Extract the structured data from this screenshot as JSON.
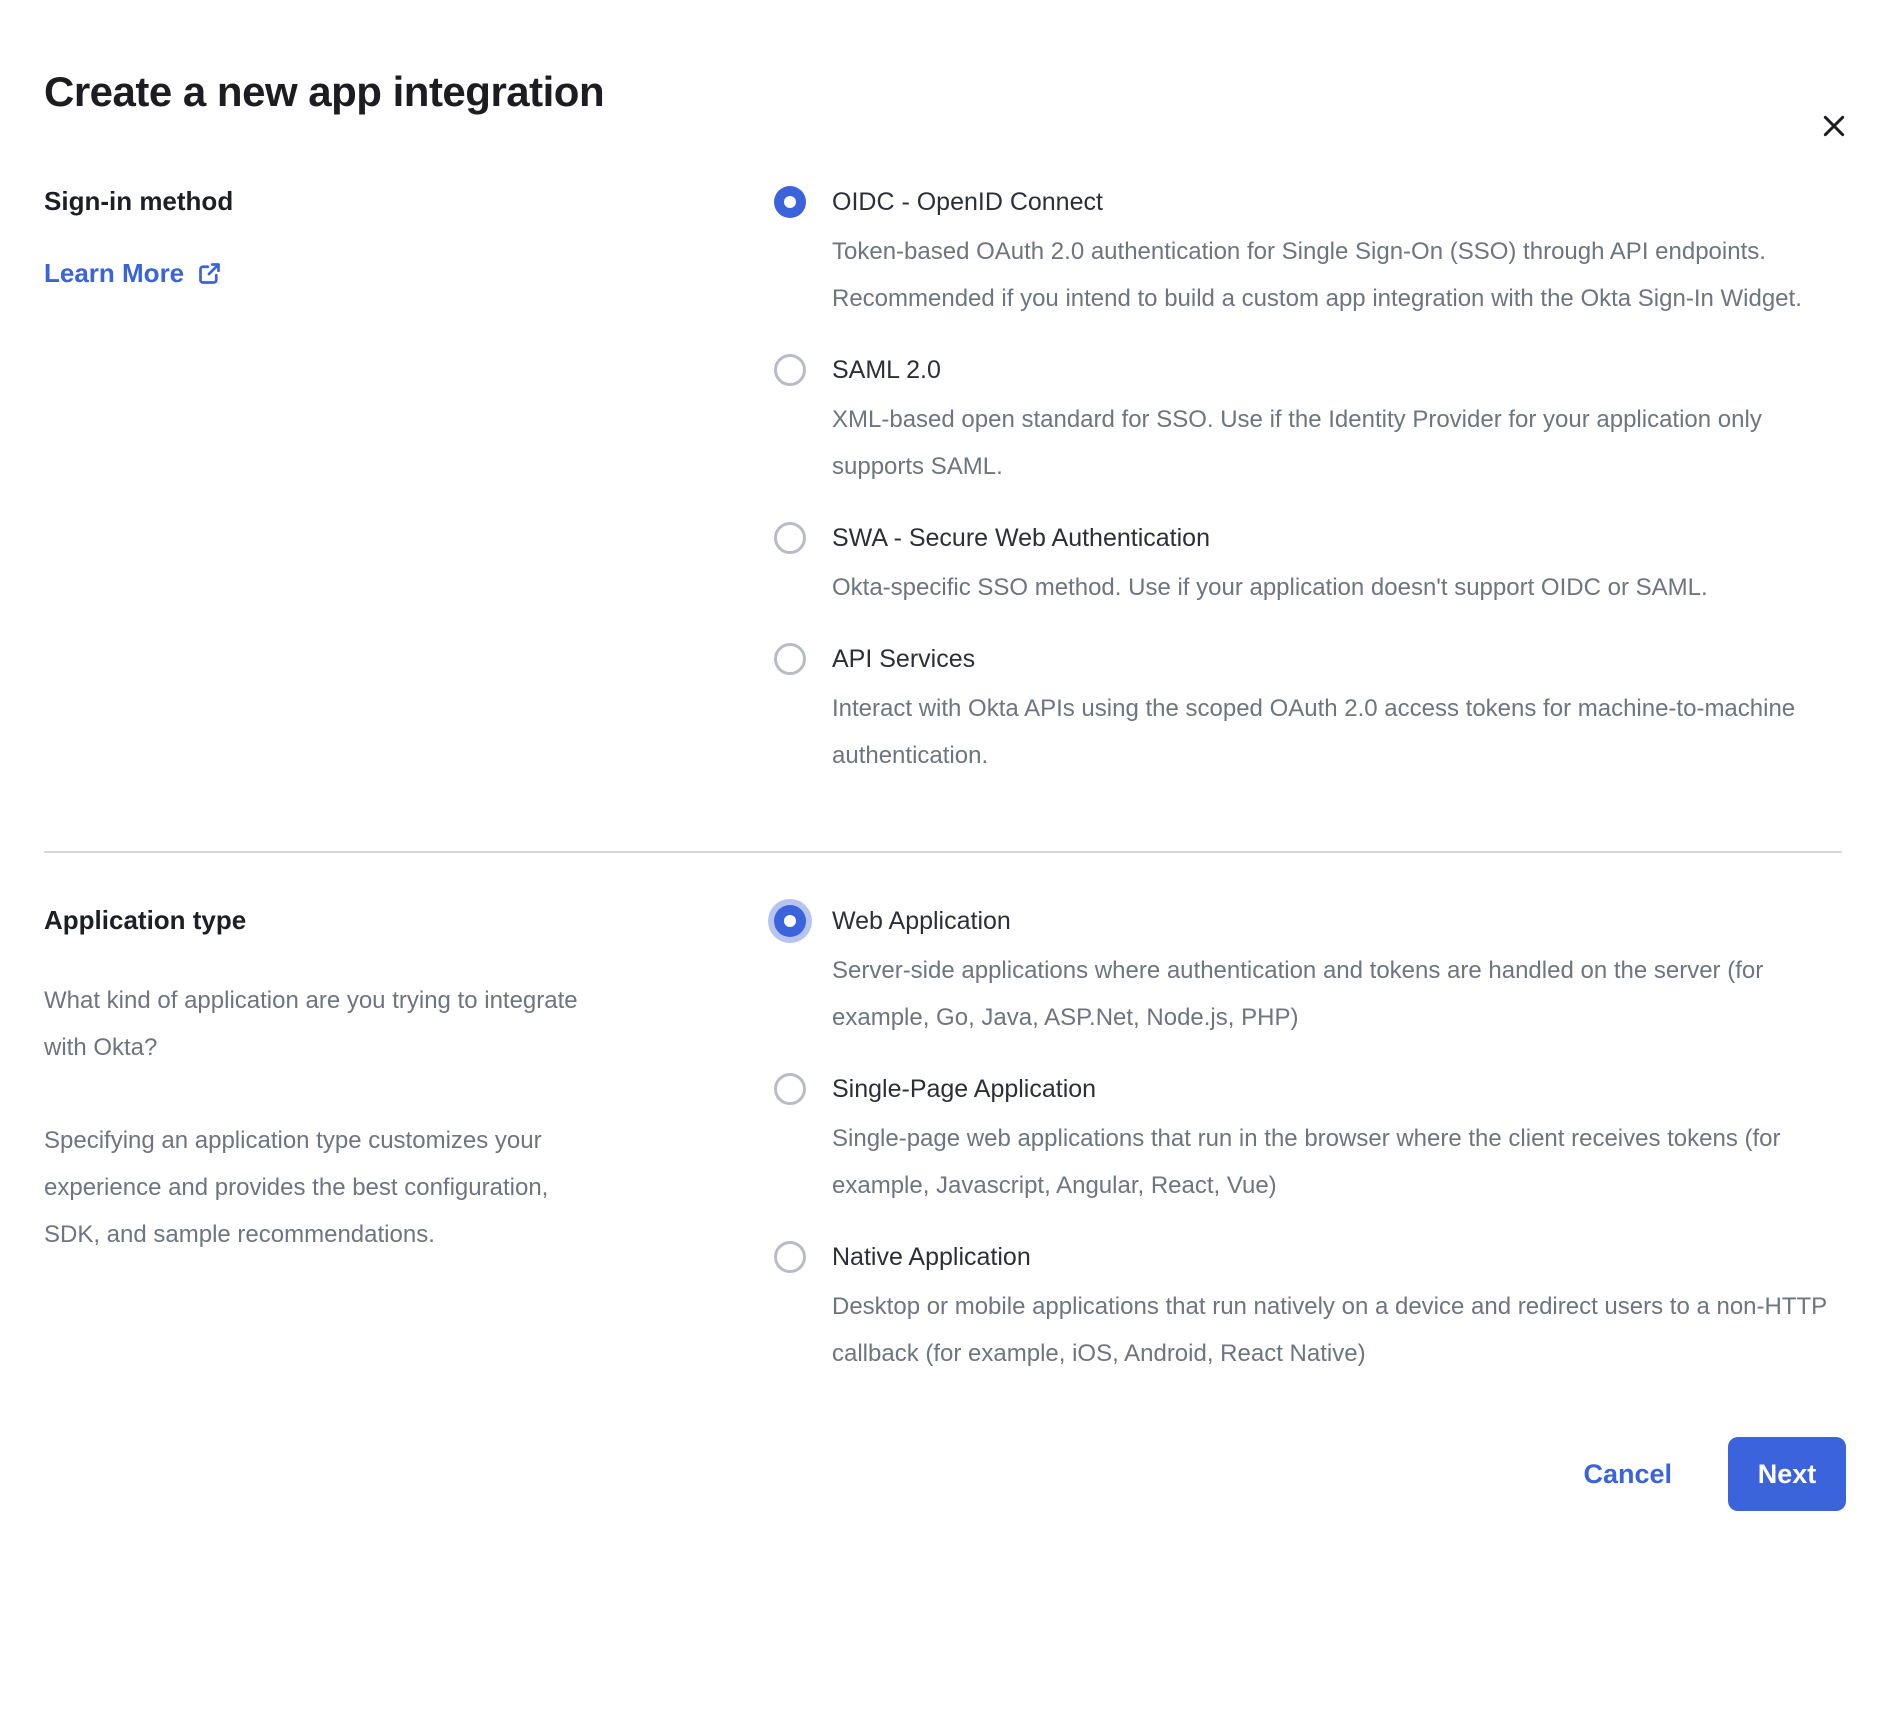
{
  "dialog": {
    "title": "Create a new app integration"
  },
  "signin": {
    "heading": "Sign-in method",
    "learn_more": "Learn More",
    "options": [
      {
        "label": "OIDC - OpenID Connect",
        "description": "Token-based OAuth 2.0 authentication for Single Sign-On (SSO) through API endpoints. Recommended if you intend to build a custom app integration with the Okta Sign-In Widget.",
        "selected": true
      },
      {
        "label": "SAML 2.0",
        "description": "XML-based open standard for SSO. Use if the Identity Provider for your application only supports SAML.",
        "selected": false
      },
      {
        "label": "SWA - Secure Web Authentication",
        "description": "Okta-specific SSO method. Use if your application doesn't support OIDC or SAML.",
        "selected": false
      },
      {
        "label": "API Services",
        "description": "Interact with Okta APIs using the scoped OAuth 2.0 access tokens for machine-to-machine authentication.",
        "selected": false
      }
    ]
  },
  "apptype": {
    "heading": "Application type",
    "question": "What kind of application are you trying to integrate with Okta?",
    "explanation": "Specifying an application type customizes your experience and provides the best configuration, SDK, and sample recommendations.",
    "options": [
      {
        "label": "Web Application",
        "description": "Server-side applications where authentication and tokens are handled on the server (for example, Go, Java, ASP.Net, Node.js, PHP)",
        "selected": true
      },
      {
        "label": "Single-Page Application",
        "description": "Single-page web applications that run in the browser where the client receives tokens (for example, Javascript, Angular, React, Vue)",
        "selected": false
      },
      {
        "label": "Native Application",
        "description": "Desktop or mobile applications that run natively on a device and redirect users to a non-HTTP callback (for example, iOS, Android, React Native)",
        "selected": false
      }
    ]
  },
  "footer": {
    "cancel": "Cancel",
    "next": "Next"
  },
  "colors": {
    "accent": "#3b63dc",
    "focus_halo": "#b7c3f1",
    "title_text": "#1d1d21",
    "label_text": "#2c2f38",
    "body_text": "#6e7480",
    "radio_border": "#b9bcc6",
    "divider": "#d8d9dd"
  }
}
